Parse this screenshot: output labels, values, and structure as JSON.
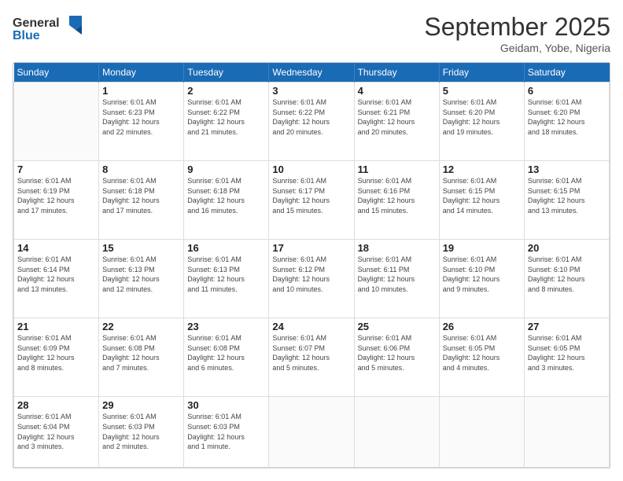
{
  "header": {
    "logo_line1": "General",
    "logo_line2": "Blue",
    "month": "September 2025",
    "location": "Geidam, Yobe, Nigeria"
  },
  "days_of_week": [
    "Sunday",
    "Monday",
    "Tuesday",
    "Wednesday",
    "Thursday",
    "Friday",
    "Saturday"
  ],
  "weeks": [
    [
      {
        "day": "",
        "info": ""
      },
      {
        "day": "1",
        "info": "Sunrise: 6:01 AM\nSunset: 6:23 PM\nDaylight: 12 hours\nand 22 minutes."
      },
      {
        "day": "2",
        "info": "Sunrise: 6:01 AM\nSunset: 6:22 PM\nDaylight: 12 hours\nand 21 minutes."
      },
      {
        "day": "3",
        "info": "Sunrise: 6:01 AM\nSunset: 6:22 PM\nDaylight: 12 hours\nand 20 minutes."
      },
      {
        "day": "4",
        "info": "Sunrise: 6:01 AM\nSunset: 6:21 PM\nDaylight: 12 hours\nand 20 minutes."
      },
      {
        "day": "5",
        "info": "Sunrise: 6:01 AM\nSunset: 6:20 PM\nDaylight: 12 hours\nand 19 minutes."
      },
      {
        "day": "6",
        "info": "Sunrise: 6:01 AM\nSunset: 6:20 PM\nDaylight: 12 hours\nand 18 minutes."
      }
    ],
    [
      {
        "day": "7",
        "info": "Sunrise: 6:01 AM\nSunset: 6:19 PM\nDaylight: 12 hours\nand 17 minutes."
      },
      {
        "day": "8",
        "info": "Sunrise: 6:01 AM\nSunset: 6:18 PM\nDaylight: 12 hours\nand 17 minutes."
      },
      {
        "day": "9",
        "info": "Sunrise: 6:01 AM\nSunset: 6:18 PM\nDaylight: 12 hours\nand 16 minutes."
      },
      {
        "day": "10",
        "info": "Sunrise: 6:01 AM\nSunset: 6:17 PM\nDaylight: 12 hours\nand 15 minutes."
      },
      {
        "day": "11",
        "info": "Sunrise: 6:01 AM\nSunset: 6:16 PM\nDaylight: 12 hours\nand 15 minutes."
      },
      {
        "day": "12",
        "info": "Sunrise: 6:01 AM\nSunset: 6:15 PM\nDaylight: 12 hours\nand 14 minutes."
      },
      {
        "day": "13",
        "info": "Sunrise: 6:01 AM\nSunset: 6:15 PM\nDaylight: 12 hours\nand 13 minutes."
      }
    ],
    [
      {
        "day": "14",
        "info": "Sunrise: 6:01 AM\nSunset: 6:14 PM\nDaylight: 12 hours\nand 13 minutes."
      },
      {
        "day": "15",
        "info": "Sunrise: 6:01 AM\nSunset: 6:13 PM\nDaylight: 12 hours\nand 12 minutes."
      },
      {
        "day": "16",
        "info": "Sunrise: 6:01 AM\nSunset: 6:13 PM\nDaylight: 12 hours\nand 11 minutes."
      },
      {
        "day": "17",
        "info": "Sunrise: 6:01 AM\nSunset: 6:12 PM\nDaylight: 12 hours\nand 10 minutes."
      },
      {
        "day": "18",
        "info": "Sunrise: 6:01 AM\nSunset: 6:11 PM\nDaylight: 12 hours\nand 10 minutes."
      },
      {
        "day": "19",
        "info": "Sunrise: 6:01 AM\nSunset: 6:10 PM\nDaylight: 12 hours\nand 9 minutes."
      },
      {
        "day": "20",
        "info": "Sunrise: 6:01 AM\nSunset: 6:10 PM\nDaylight: 12 hours\nand 8 minutes."
      }
    ],
    [
      {
        "day": "21",
        "info": "Sunrise: 6:01 AM\nSunset: 6:09 PM\nDaylight: 12 hours\nand 8 minutes."
      },
      {
        "day": "22",
        "info": "Sunrise: 6:01 AM\nSunset: 6:08 PM\nDaylight: 12 hours\nand 7 minutes."
      },
      {
        "day": "23",
        "info": "Sunrise: 6:01 AM\nSunset: 6:08 PM\nDaylight: 12 hours\nand 6 minutes."
      },
      {
        "day": "24",
        "info": "Sunrise: 6:01 AM\nSunset: 6:07 PM\nDaylight: 12 hours\nand 5 minutes."
      },
      {
        "day": "25",
        "info": "Sunrise: 6:01 AM\nSunset: 6:06 PM\nDaylight: 12 hours\nand 5 minutes."
      },
      {
        "day": "26",
        "info": "Sunrise: 6:01 AM\nSunset: 6:05 PM\nDaylight: 12 hours\nand 4 minutes."
      },
      {
        "day": "27",
        "info": "Sunrise: 6:01 AM\nSunset: 6:05 PM\nDaylight: 12 hours\nand 3 minutes."
      }
    ],
    [
      {
        "day": "28",
        "info": "Sunrise: 6:01 AM\nSunset: 6:04 PM\nDaylight: 12 hours\nand 3 minutes."
      },
      {
        "day": "29",
        "info": "Sunrise: 6:01 AM\nSunset: 6:03 PM\nDaylight: 12 hours\nand 2 minutes."
      },
      {
        "day": "30",
        "info": "Sunrise: 6:01 AM\nSunset: 6:03 PM\nDaylight: 12 hours\nand 1 minute."
      },
      {
        "day": "",
        "info": ""
      },
      {
        "day": "",
        "info": ""
      },
      {
        "day": "",
        "info": ""
      },
      {
        "day": "",
        "info": ""
      }
    ]
  ]
}
